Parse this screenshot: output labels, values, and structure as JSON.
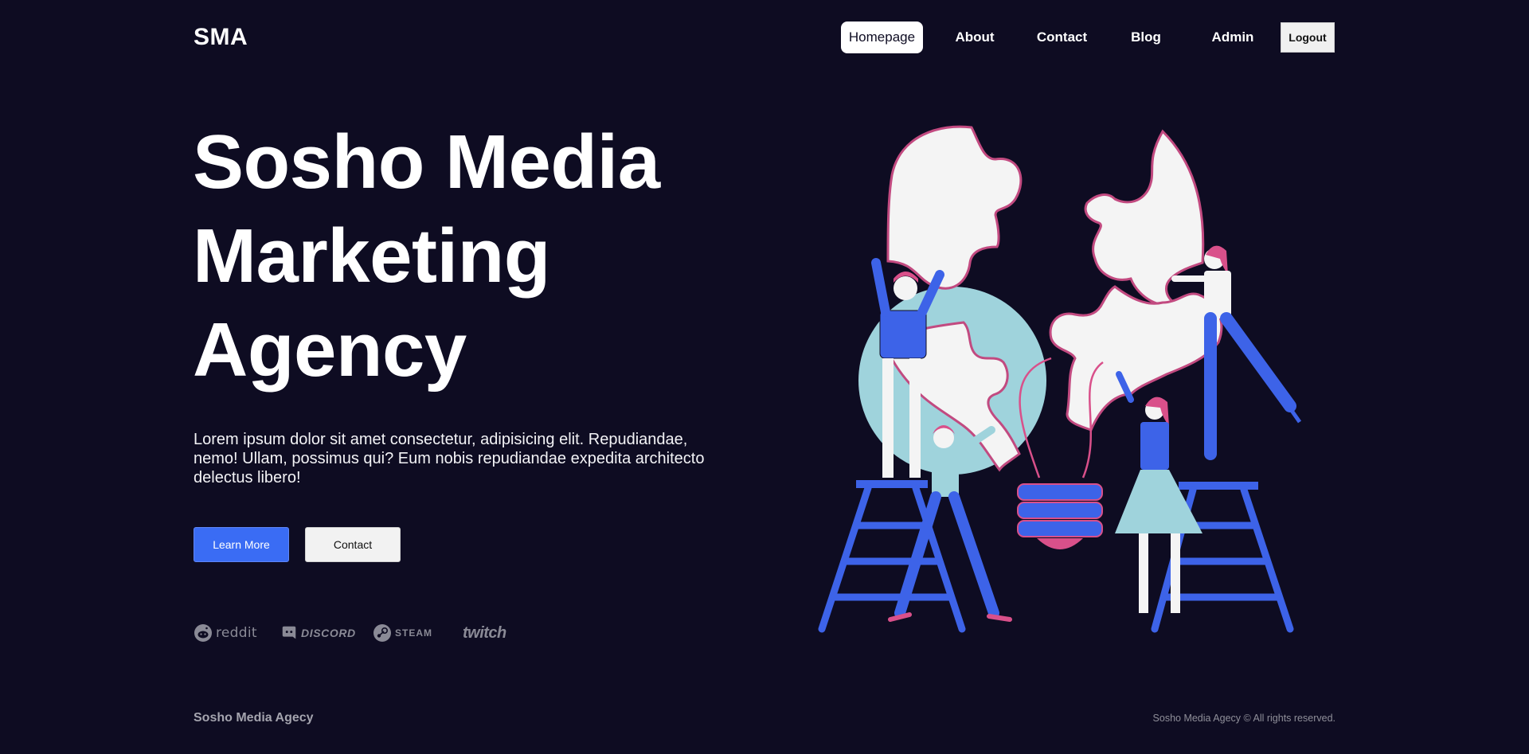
{
  "brand": {
    "logo": "SMA"
  },
  "nav": {
    "items": [
      {
        "label": "Homepage",
        "active": true
      },
      {
        "label": "About",
        "active": false
      },
      {
        "label": "Contact",
        "active": false
      },
      {
        "label": "Blog",
        "active": false
      },
      {
        "label": "Admin",
        "active": false
      }
    ],
    "logout_label": "Logout"
  },
  "hero": {
    "title_lines": [
      "Sosho Media",
      "Marketing",
      "Agency"
    ],
    "description": "Lorem ipsum dolor sit amet consectetur, adipisicing elit. Repudiandae, nemo! Ullam, possimus qui? Eum nobis repudiandae expedita architecto delectus libero!",
    "primary_button": "Learn More",
    "secondary_button": "Contact"
  },
  "brands": [
    {
      "name": "reddit",
      "icon": "reddit-icon"
    },
    {
      "name": "DISCORD",
      "icon": "discord-icon"
    },
    {
      "name": "STEAM",
      "icon": "steam-icon"
    },
    {
      "name": "twitch",
      "icon": "twitch-icon"
    }
  ],
  "footer": {
    "name": "Sosho Media Agecy",
    "copyright": "Sosho Media Agecy © All rights reserved."
  },
  "colors": {
    "background": "#0e0c22",
    "accent": "#3a6cf4",
    "illustration_blue": "#3d63e8",
    "illustration_pink": "#d9508a",
    "illustration_light_blue": "#9fd3dc"
  }
}
